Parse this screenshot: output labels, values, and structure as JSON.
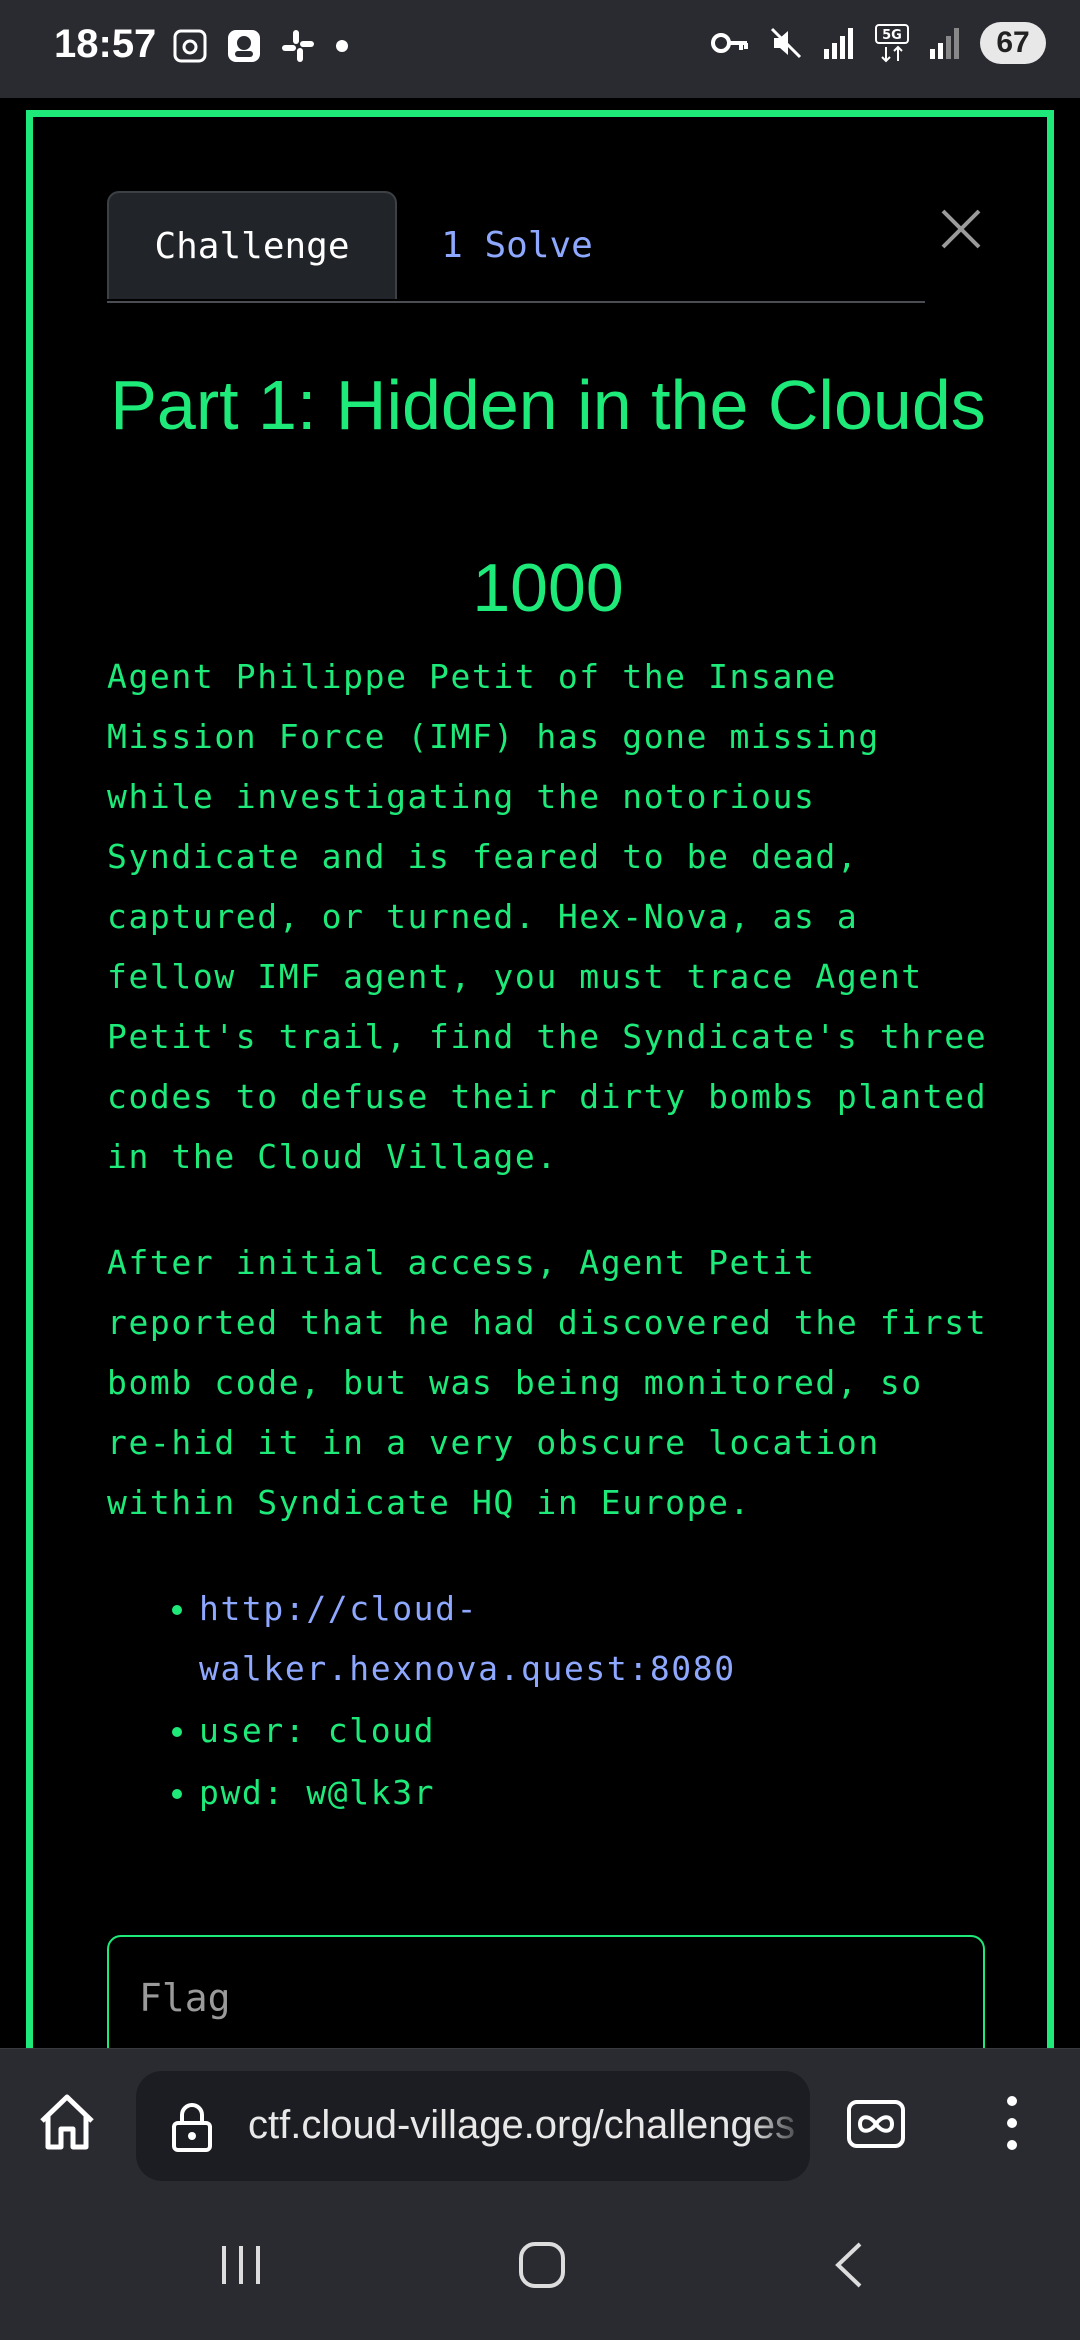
{
  "status_bar": {
    "time": "18:57",
    "left_icons": [
      "screenshot-icon",
      "app-icon",
      "slack-icon",
      "dot-icon"
    ],
    "right_icons": [
      "vpn-key-icon",
      "mute-icon",
      "signal-icon",
      "5g-icon",
      "signal-icon"
    ],
    "battery": "67"
  },
  "modal": {
    "tabs": [
      {
        "label": "Challenge",
        "active": true
      },
      {
        "label": "1 Solve",
        "active": false
      }
    ],
    "title": "Part 1: Hidden in the Clouds",
    "points": "1000",
    "description": {
      "paragraph1": "Agent Philippe Petit of the Insane Mission Force (IMF) has gone missing while investigating the notorious Syndicate and is feared to be dead, captured, or turned. Hex-Nova, as a fellow IMF agent, you must trace Agent Petit's trail, find the Syndicate's three codes to defuse their dirty bombs planted in the Cloud Village.",
      "paragraph2": "After initial access, Agent Petit reported that he had discovered the first bomb code, but was being monitored, so re-hid it in a very obscure location within Syndicate HQ in Europe.",
      "list": [
        {
          "text": "http://cloud-walker.hexnova.quest:8080",
          "is_link": true
        },
        {
          "text": "user: cloud",
          "is_link": false
        },
        {
          "text": "pwd: w@lk3r",
          "is_link": false
        }
      ]
    },
    "flag_input": {
      "placeholder": "Flag",
      "value": ""
    }
  },
  "browser": {
    "url": "ctf.cloud-village.org/challenges"
  },
  "colors": {
    "accent": "#1eea7a",
    "link": "#8ea8ff",
    "chrome": "#2a2b31"
  }
}
